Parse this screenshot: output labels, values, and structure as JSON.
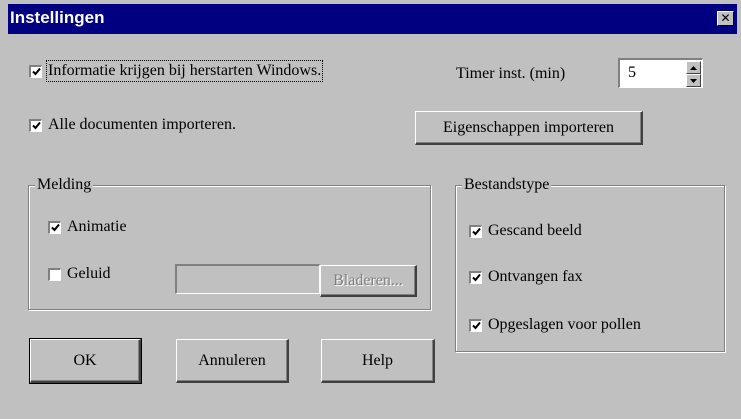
{
  "window": {
    "title": "Instellingen",
    "close_glyph": "✕"
  },
  "options": {
    "info_restart": {
      "label": "Informatie krijgen bij herstarten Windows.",
      "checked": true
    },
    "import_all": {
      "label": "Alle documenten importeren.",
      "checked": true
    }
  },
  "timer": {
    "label": "Timer inst. (min)",
    "value": "5"
  },
  "properties_button": "Eigenschappen importeren",
  "notification": {
    "legend": "Melding",
    "animation": {
      "label": "Animatie",
      "checked": true
    },
    "sound": {
      "label": "Geluid",
      "checked": false
    },
    "sound_path": "",
    "browse_button": "Bladeren..."
  },
  "filetype": {
    "legend": "Bestandstype",
    "items": [
      {
        "label": "Gescand beeld",
        "checked": true
      },
      {
        "label": "Ontvangen fax",
        "checked": true
      },
      {
        "label": "Opgeslagen voor pollen",
        "checked": true
      }
    ]
  },
  "buttons": {
    "ok": "OK",
    "cancel": "Annuleren",
    "help": "Help"
  },
  "icons": {
    "check": "check-icon",
    "close": "close-icon",
    "spin_up": "triangle-up-icon",
    "spin_down": "triangle-down-icon"
  }
}
